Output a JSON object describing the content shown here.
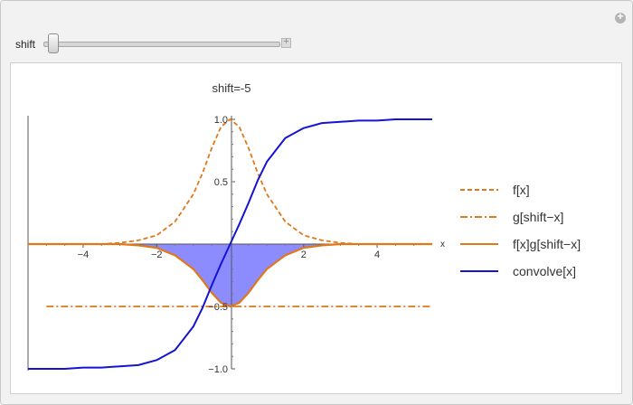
{
  "controls": {
    "shift_label": "shift",
    "shift_value": -5,
    "shift_min": -5,
    "shift_max": 5
  },
  "chart_data": {
    "type": "line",
    "title": "shift=-5",
    "xlabel": "x",
    "ylabel": "",
    "xlim": [
      -5.5,
      5.5
    ],
    "ylim": [
      -1.0,
      1.0
    ],
    "x_ticks": [
      "-4",
      "-2",
      "2",
      "4"
    ],
    "y_ticks": [
      "1.0",
      "0.5",
      "-0.5",
      "-1.0"
    ],
    "legend_position": "right",
    "grid": false,
    "colors": {
      "orange": "#e0781a",
      "blue": "#1414d2",
      "fill": "#8080ff"
    },
    "x": [
      -5.5,
      -5.0,
      -4.5,
      -4.0,
      -3.5,
      -3.0,
      -2.5,
      -2.0,
      -1.5,
      -1.0,
      -0.75,
      -0.5,
      -0.25,
      0.0,
      0.25,
      0.5,
      0.75,
      1.0,
      1.5,
      2.0,
      2.5,
      3.0,
      3.5,
      4.0,
      4.5,
      5.0,
      5.5
    ],
    "series": [
      {
        "name": "f[x]",
        "style": "dashed",
        "color": "#e0781a",
        "values": [
          0.0,
          0.0,
          0.0,
          0.0,
          0.0,
          0.01,
          0.03,
          0.07,
          0.18,
          0.4,
          0.57,
          0.77,
          0.94,
          1.0,
          0.94,
          0.77,
          0.57,
          0.4,
          0.18,
          0.07,
          0.03,
          0.01,
          0.0,
          0.0,
          0.0,
          0.0,
          0.0
        ]
      },
      {
        "name": "g[shift−x]",
        "style": "dashdot",
        "color": "#e0781a",
        "values": [
          0.0,
          -0.5,
          -0.5,
          -0.5,
          -0.5,
          -0.5,
          -0.5,
          -0.5,
          -0.5,
          -0.5,
          -0.5,
          -0.5,
          -0.5,
          -0.5,
          -0.5,
          -0.5,
          -0.5,
          -0.5,
          -0.5,
          -0.5,
          -0.5,
          -0.5,
          -0.5,
          -0.5,
          -0.5,
          -0.5,
          -0.5
        ]
      },
      {
        "name": "f[x]g[shift−x]",
        "style": "solid",
        "color": "#e0781a",
        "filled": true,
        "values": [
          0.0,
          0.0,
          0.0,
          0.0,
          0.0,
          0.0,
          -0.01,
          -0.03,
          -0.09,
          -0.2,
          -0.29,
          -0.39,
          -0.47,
          -0.5,
          -0.47,
          -0.39,
          -0.29,
          -0.2,
          -0.09,
          -0.03,
          -0.01,
          0.0,
          0.0,
          0.0,
          0.0,
          0.0,
          0.0
        ]
      },
      {
        "name": "convolve[x]",
        "style": "solid",
        "color": "#1414d2",
        "values": [
          -1.0,
          -1.0,
          -1.0,
          -0.99,
          -0.99,
          -0.98,
          -0.97,
          -0.93,
          -0.85,
          -0.66,
          -0.51,
          -0.33,
          -0.16,
          0.0,
          0.16,
          0.33,
          0.51,
          0.66,
          0.85,
          0.93,
          0.97,
          0.98,
          0.99,
          0.99,
          1.0,
          1.0,
          1.0
        ]
      }
    ]
  }
}
